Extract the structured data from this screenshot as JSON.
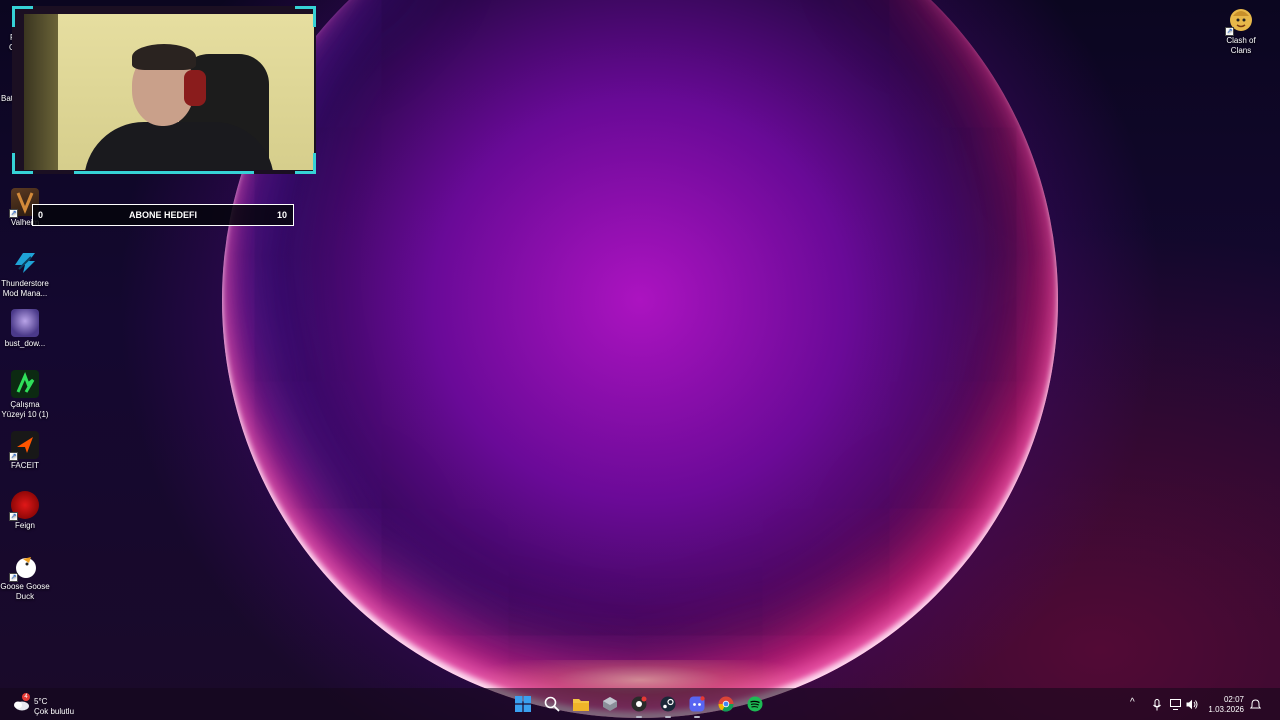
{
  "webcam": {
    "border_color": "#36d2d6"
  },
  "goal": {
    "start": "0",
    "title": "ABONE HEDEFI",
    "end": "10"
  },
  "desktop_icons": [
    {
      "label": "Valheim",
      "icon": "valheim-icon"
    },
    {
      "label": "Thunderstore Mod Mana...",
      "icon": "thunderstore-icon"
    },
    {
      "label": "bust_dow...",
      "icon": "bust-down-icon"
    },
    {
      "label": "Çalışma Yüzeyi 10 (1)",
      "icon": "workspace-icon"
    },
    {
      "label": "FACEIT",
      "icon": "faceit-icon"
    },
    {
      "label": "Feign",
      "icon": "feign-icon"
    },
    {
      "label": "Goose Goose Duck",
      "icon": "goose-goose-duck-icon"
    },
    {
      "label": "Clash of Clans",
      "icon": "clash-of-clans-icon"
    }
  ],
  "partial_labels": {
    "r": "R",
    "g": "G",
    "bat": "Bat"
  },
  "weather": {
    "temp": "5°C",
    "condition": "Çok bulutlu",
    "badge": "4"
  },
  "taskbar_apps": [
    {
      "name": "start-icon"
    },
    {
      "name": "search-icon"
    },
    {
      "name": "file-explorer-icon"
    },
    {
      "name": "cube-app-icon"
    },
    {
      "name": "obs-icon"
    },
    {
      "name": "steam-icon"
    },
    {
      "name": "discord-icon"
    },
    {
      "name": "chrome-icon"
    },
    {
      "name": "spotify-icon"
    }
  ],
  "tray": {
    "chevron": "^",
    "time": "02:07",
    "date": "1.03.2026"
  }
}
